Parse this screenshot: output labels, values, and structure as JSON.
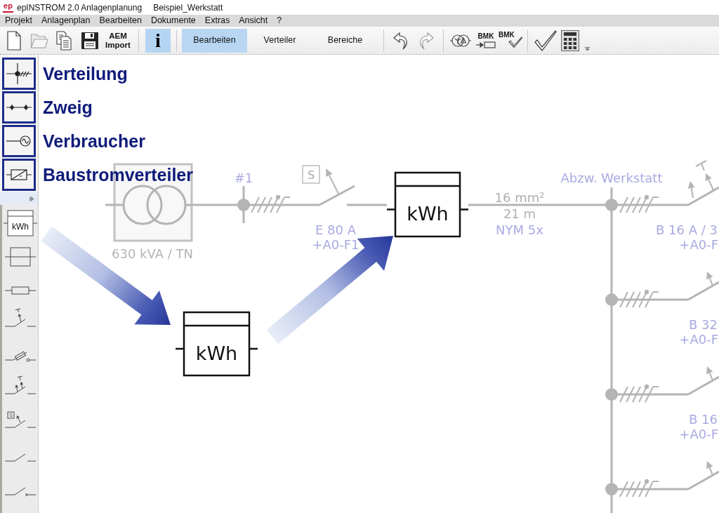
{
  "window": {
    "logo": "ep",
    "title": "epINSTROM 2.0 Anlagenplanung",
    "document": "Beispiel_Werkstatt"
  },
  "menu": [
    "Projekt",
    "Anlagenplan",
    "Bearbeiten",
    "Dokumente",
    "Extras",
    "Ansicht",
    "?"
  ],
  "toolbar": {
    "file_buttons": [
      {
        "kind": "new",
        "disabled": false
      },
      {
        "kind": "open",
        "disabled": true
      },
      {
        "kind": "copy",
        "disabled": false
      },
      {
        "kind": "save",
        "disabled": false
      }
    ],
    "aem_import": {
      "line_1": "AEM",
      "line_2": "Import"
    },
    "info_button": {
      "label": "i",
      "selected": true
    },
    "modes": [
      {
        "label": "Bearbeiten",
        "selected": true
      },
      {
        "label": "Verteiler",
        "selected": false
      },
      {
        "label": "Bereiche",
        "selected": false
      }
    ],
    "history": [
      {
        "kind": "undo",
        "disabled": false
      },
      {
        "kind": "redo",
        "disabled": true
      }
    ],
    "tools": [
      {
        "kind": "transformer"
      },
      {
        "kind": "bmk_assign",
        "label": "BMK"
      },
      {
        "kind": "bmk_check",
        "label": "BMK"
      }
    ],
    "actions": [
      {
        "kind": "check"
      },
      {
        "kind": "calculator"
      }
    ]
  },
  "palette": {
    "categories": [
      {
        "kind": "distribution",
        "label": "Verteilung"
      },
      {
        "kind": "branch",
        "label": "Zweig"
      },
      {
        "kind": "consumer",
        "label": "Verbraucher"
      },
      {
        "kind": "site_distributor",
        "label": "Baustromverteiler"
      }
    ],
    "symbols": [
      {
        "kind": "meter",
        "label": "kWh"
      },
      {
        "kind": "terminal"
      },
      {
        "kind": "fuse"
      },
      {
        "kind": "breaker"
      },
      {
        "kind": "fuse_switch"
      },
      {
        "kind": "rcd"
      },
      {
        "kind": "selective",
        "label": "S"
      },
      {
        "kind": "switch"
      },
      {
        "kind": "disconnector"
      }
    ]
  },
  "diagram": {
    "transformer": {
      "rating": "630 kVA / TN"
    },
    "feeder": {
      "node_label": "#1",
      "selective_mark": "S",
      "protection": "E 80 A",
      "designation": "+A0-F1"
    },
    "meter": {
      "label": "kWh"
    },
    "cable": {
      "cross_section": "16 mm²",
      "length": "21 m",
      "type": "NYM 5x"
    },
    "distribution": {
      "name": "Abzw. Werkstatt",
      "branches": [
        {
          "kind": "rcd_breaker",
          "protection": "B 16 A / 3",
          "designation": "+A0-F"
        },
        {
          "kind": "breaker",
          "protection": "B 32",
          "designation": "+A0-F"
        },
        {
          "kind": "breaker",
          "protection": "B 16",
          "designation": "+A0-F"
        },
        {
          "kind": "breaker"
        }
      ]
    }
  },
  "tutorial": {
    "example_meter": {
      "label": "kWh"
    }
  }
}
